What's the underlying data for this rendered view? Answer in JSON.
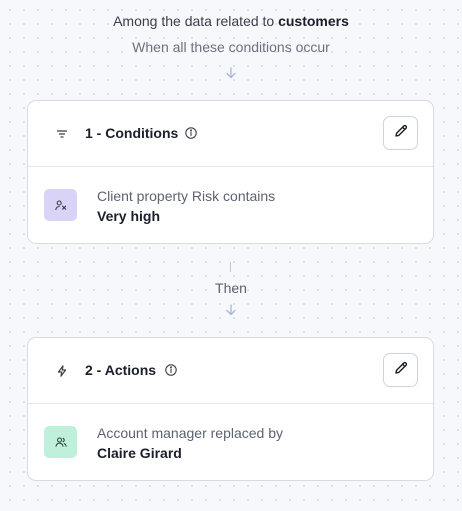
{
  "header": {
    "intro_prefix": "Among the data related to",
    "intro_entity": "customers",
    "subtitle": "When all these conditions occur"
  },
  "conditions": {
    "title": "1 - Conditions",
    "icon": "filter-icon",
    "rule_text": "Client property Risk contains",
    "rule_value": "Very high",
    "badge_icon": "user-property-icon",
    "badge_color": "#d9d4f7"
  },
  "connector": {
    "label": "Then"
  },
  "actions": {
    "title": "2 - Actions",
    "icon": "lightning-icon",
    "rule_text": "Account manager replaced by",
    "rule_value": "Claire Girard",
    "badge_icon": "users-icon",
    "badge_color": "#bff0dc"
  },
  "colors": {
    "arrow": "#a8b6d4",
    "card_border": "#d7dbe3"
  }
}
